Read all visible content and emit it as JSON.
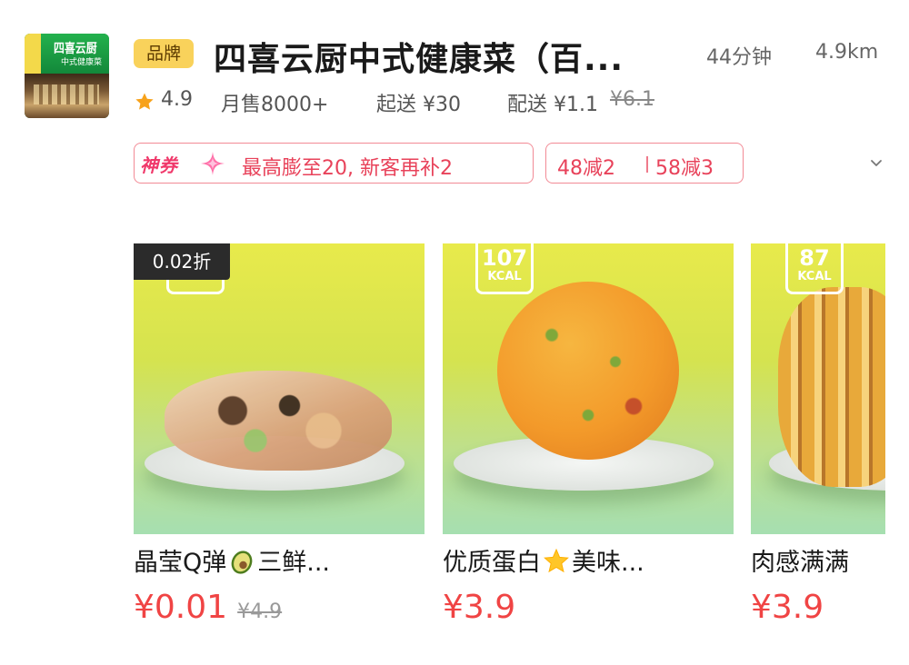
{
  "store": {
    "logo_line1": "四喜云厨",
    "logo_line2": "中式健康菜",
    "brand_badge": "品牌",
    "name": "四喜云厨中式健康菜（百...",
    "delivery_time": "44分钟",
    "distance": "4.9km",
    "rating": "4.9",
    "monthly_sales": "月售8000+",
    "min_order": "起送 ¥30",
    "delivery_fee": "配送 ¥1.1",
    "original_delivery_fee": "¥6.1"
  },
  "promotions": {
    "coupon_tag": "神券",
    "coupon_text": "最高膨至20, 新客再补2",
    "discount_1": "48减2",
    "discount_2": "58减3"
  },
  "products": [
    {
      "discount_badge": "0.02折",
      "title_before_icon": "晶莹Q弹",
      "title_after_icon": "三鲜...",
      "price": "¥0.01",
      "original_price": "¥4.9"
    },
    {
      "kcal": "107",
      "kcal_unit": "KCAL",
      "title_before_icon": "优质蛋白",
      "title_after_icon": "美味...",
      "price": "¥3.9"
    },
    {
      "kcal": "87",
      "kcal_unit": "KCAL",
      "title_before_icon": "肉感满满",
      "price": "¥3.9"
    }
  ],
  "colors": {
    "price_red": "#f04444",
    "promo_red": "#e8425a",
    "brand_badge_yellow": "#f9d25b"
  }
}
